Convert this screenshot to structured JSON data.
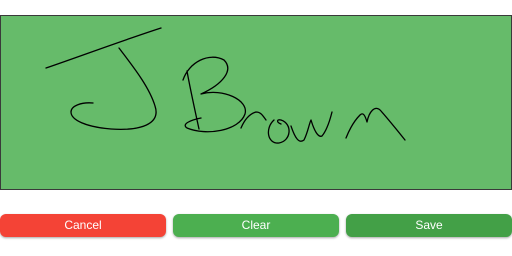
{
  "signature_pad": {
    "background_color": "#66bb6a",
    "stroke_color": "#000000",
    "signature_text": "J Brown"
  },
  "actions": {
    "cancel_label": "Cancel",
    "clear_label": "Clear",
    "save_label": "Save",
    "cancel_color": "#f44336",
    "clear_color": "#4caf50",
    "save_color": "#43a047"
  }
}
